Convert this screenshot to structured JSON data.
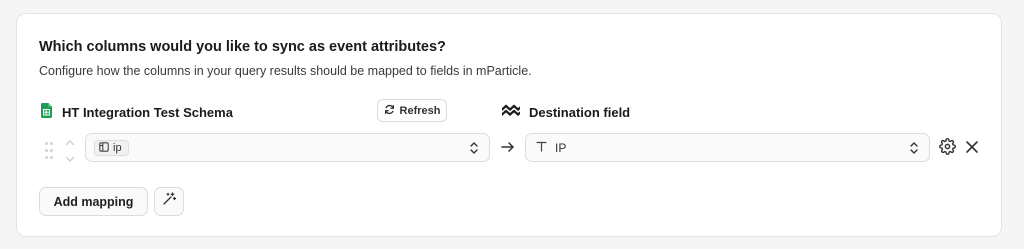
{
  "section": {
    "title": "Which columns would you like to sync as event attributes?",
    "subtitle": "Configure how the columns in your query results should be mapped to fields in mParticle."
  },
  "source": {
    "name": "HT Integration Test Schema",
    "icon": "google-sheets-icon",
    "refresh_label": "Refresh"
  },
  "destination": {
    "label": "Destination field",
    "icon": "mparticle-logo-icon"
  },
  "mappings": [
    {
      "source_column": "ip",
      "source_icon": "table-column-icon",
      "destination_field": "IP",
      "destination_icon": "text-type-icon"
    }
  ],
  "actions": {
    "add_mapping_label": "Add mapping"
  },
  "colors": {
    "sheets_green": "#1e9d55",
    "border": "#dcdcdc",
    "text": "#1a1a1a"
  }
}
